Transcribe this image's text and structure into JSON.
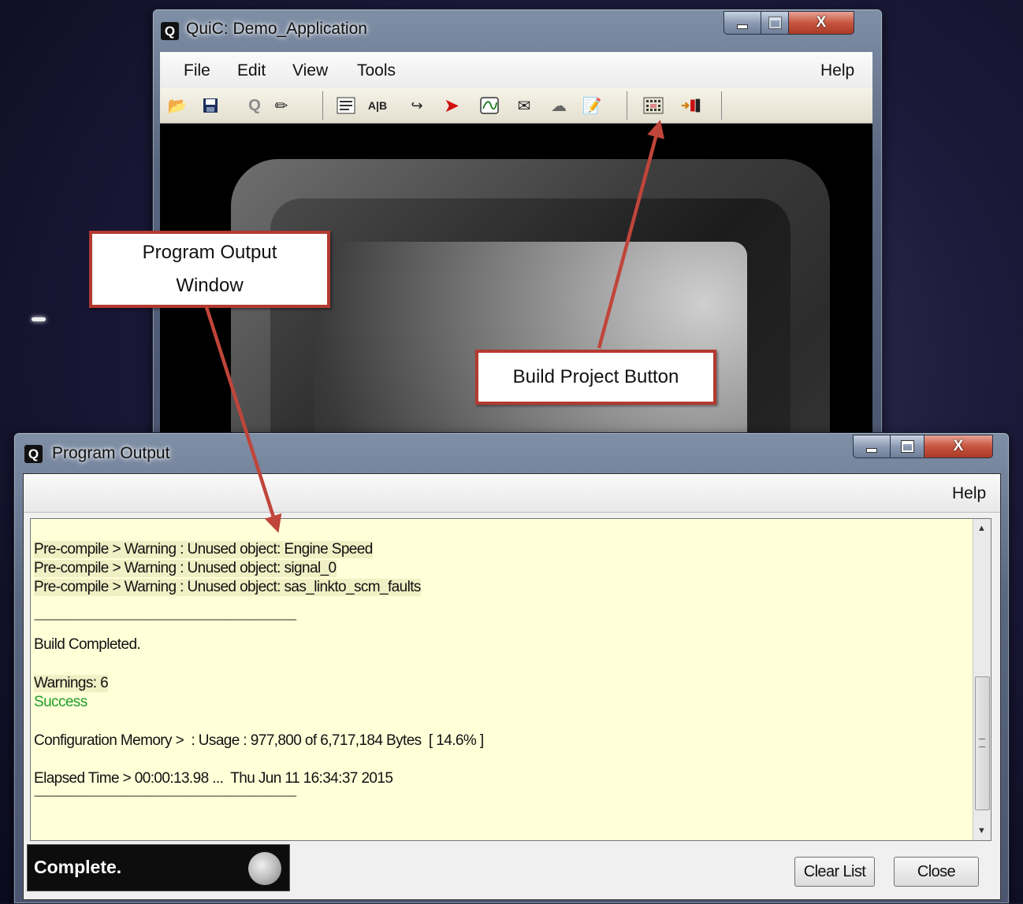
{
  "main_window": {
    "title": "QuiC: Demo_Application",
    "logo": "Q",
    "menu": [
      "File",
      "Edit",
      "View",
      "Tools",
      "Help"
    ],
    "toolbar_icons": [
      "open-folder-icon",
      "save-icon",
      "quic-icon",
      "pencil-icon",
      "properties-icon",
      "ab-compare-icon",
      "signal-route-icon",
      "arrow-icon",
      "waveform-icon",
      "message-icon",
      "cloud-icon",
      "edit-note-icon",
      "build-project-icon",
      "exit-icon"
    ]
  },
  "output_window": {
    "title": "Program Output",
    "logo": "Q",
    "menu_help": "Help",
    "log": {
      "warn1": "Pre-compile > Warning : Unused object: Engine Speed",
      "warn2": "Pre-compile > Warning : Unused object: signal_0",
      "warn3": "Pre-compile > Warning : Unused object: sas_linkto_scm_faults",
      "sep1": "---------------------------------------------------------------------------------------------------------------",
      "build": "Build Completed.",
      "warnings": "Warnings: 6",
      "success": "Success",
      "memory": "Configuration Memory >  : Usage : 977,800 of 6,717,184 Bytes  [ 14.6% ]",
      "elapsed": "Elapsed Time > 00:00:13.98 ...  Thu Jun 11 16:34:37 2015",
      "sep2": "---------------------------------------------------------------------------------------------------------------"
    },
    "status": "Complete.",
    "buttons": {
      "clear": "Clear List",
      "close": "Close"
    }
  },
  "callouts": {
    "output": "Program Output Window",
    "build": "Build Project Button"
  },
  "colors": {
    "callout_border": "#b33a30",
    "arrow": "#c0453a",
    "log_bg": "#ffffd8",
    "success": "#1e9e2a"
  }
}
